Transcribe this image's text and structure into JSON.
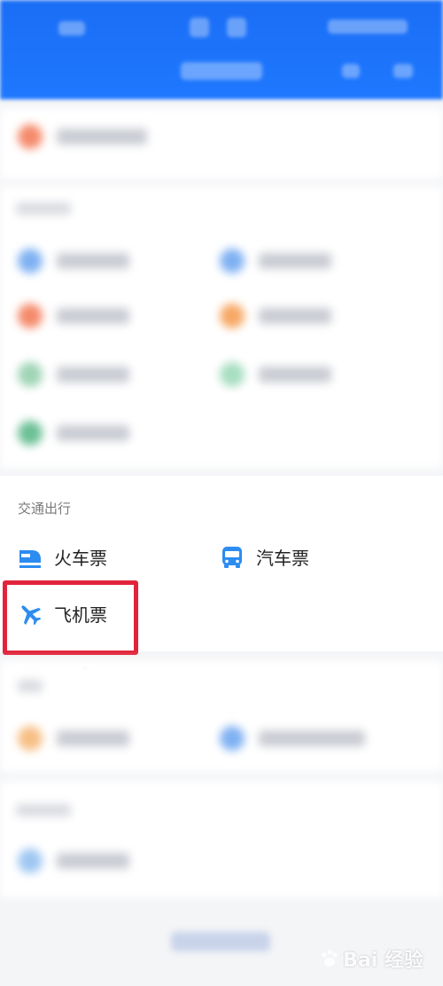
{
  "transport": {
    "title": "交通出行",
    "items": [
      {
        "label": "火车票",
        "icon": "train-icon",
        "color": "#2d8cf0"
      },
      {
        "label": "汽车票",
        "icon": "bus-icon",
        "color": "#2d8cf0"
      },
      {
        "label": "飞机票",
        "icon": "airplane-icon",
        "color": "#2d8cf0"
      }
    ]
  },
  "highlight_color": "#e0243b",
  "header_color": "#1f78ff",
  "watermark": {
    "text": "Bai 经验"
  }
}
